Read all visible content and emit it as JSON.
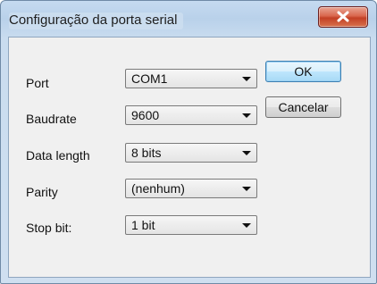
{
  "window": {
    "title": "Configuração da porta serial"
  },
  "form": {
    "port": {
      "label": "Port",
      "value": "COM1"
    },
    "baudrate": {
      "label": "Baudrate",
      "value": "9600"
    },
    "data_length": {
      "label": "Data length",
      "value": "8 bits"
    },
    "parity": {
      "label": "Parity",
      "value": "(nenhum)"
    },
    "stop_bit": {
      "label": "Stop bit:",
      "value": "1 bit"
    }
  },
  "buttons": {
    "ok": "OK",
    "cancel": "Cancelar"
  },
  "icons": {
    "close": "close-icon",
    "dropdown": "chevron-down-icon"
  }
}
